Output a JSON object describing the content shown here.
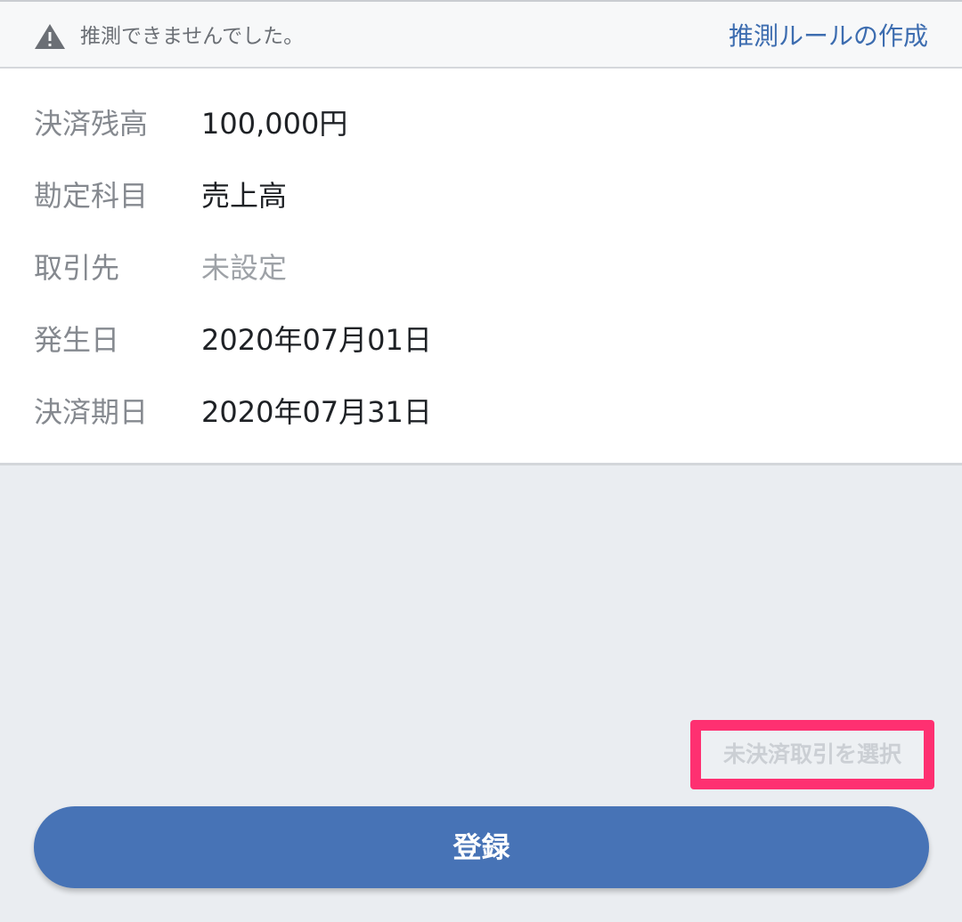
{
  "notice": {
    "icon": "warning-icon",
    "message": "推測できませんでした。",
    "create_rule_link": "推測ルールの作成"
  },
  "details": [
    {
      "key": "balance",
      "label": "決済残高",
      "value": "100,000円",
      "muted": false
    },
    {
      "key": "account",
      "label": "勘定科目",
      "value": "売上高",
      "muted": false
    },
    {
      "key": "partner",
      "label": "取引先",
      "value": "未設定",
      "muted": true
    },
    {
      "key": "issue-date",
      "label": "発生日",
      "value": "2020年07月01日",
      "muted": false
    },
    {
      "key": "due-date",
      "label": "決済期日",
      "value": "2020年07月31日",
      "muted": false
    }
  ],
  "actions": {
    "select_unsettled_label": "未決済取引を選択",
    "register_label": "登録"
  },
  "colors": {
    "link": "#3d6db0",
    "primary_button": "#4773b6",
    "highlight": "#fe3071",
    "background": "#eaedf1"
  }
}
